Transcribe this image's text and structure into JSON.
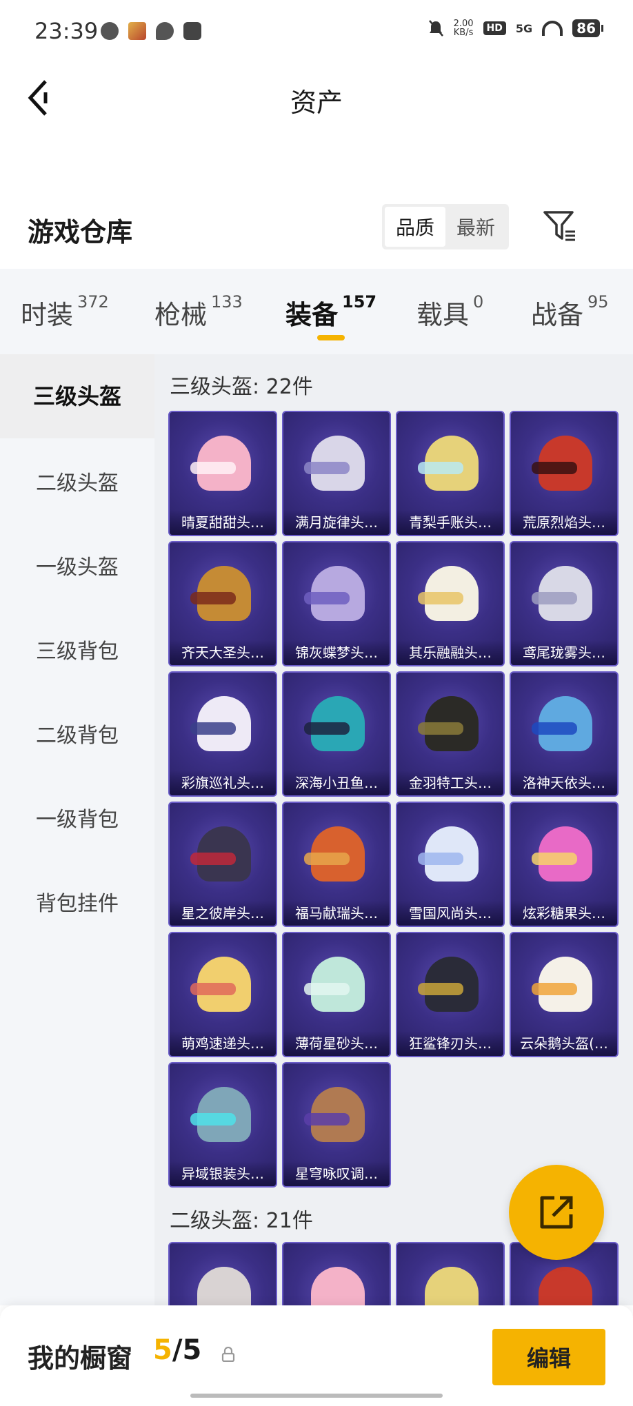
{
  "status_bar": {
    "time": "23:39",
    "net_speed_value": "2.00",
    "net_speed_unit": "KB/s",
    "hd": "HD",
    "signal": "5G",
    "battery": "86"
  },
  "header": {
    "title": "资产"
  },
  "warehouse": {
    "title": "游戏仓库",
    "sort_options": [
      "品质",
      "最新"
    ]
  },
  "tabs": [
    {
      "label": "时装",
      "count": "372"
    },
    {
      "label": "枪械",
      "count": "133"
    },
    {
      "label": "装备",
      "count": "157"
    },
    {
      "label": "载具",
      "count": "0"
    },
    {
      "label": "战备",
      "count": "95"
    }
  ],
  "sidebar": {
    "items": [
      "三级头盔",
      "二级头盔",
      "一级头盔",
      "三级背包",
      "二级背包",
      "一级背包",
      "背包挂件"
    ]
  },
  "sections": [
    {
      "title": "三级头盔: 22件",
      "items": [
        "晴夏甜甜头…",
        "满月旋律头…",
        "青梨手账头…",
        "荒原烈焰头…",
        "齐天大圣头…",
        "锦灰蝶梦头…",
        "其乐融融头…",
        "鸢尾珑雾头…",
        "彩旗巡礼头…",
        "深海小丑鱼…",
        "金羽特工头…",
        "洛神天依头…",
        "星之彼岸头…",
        "福马献瑞头…",
        "雪国风尚头…",
        "炫彩糖果头…",
        "萌鸡速递头…",
        "薄荷星砂头…",
        "狂鲨锋刃头…",
        "云朵鹅头盔(…",
        "异域银装头…",
        "星穹咏叹调…"
      ]
    },
    {
      "title": "二级头盔: 21件"
    }
  ],
  "bottom_bar": {
    "label": "我的橱窗",
    "count_current": "5",
    "count_total": "/5",
    "edit_label": "编辑"
  },
  "colors": {
    "accent": "#f5b301",
    "item_bg": "#3b2f86"
  }
}
